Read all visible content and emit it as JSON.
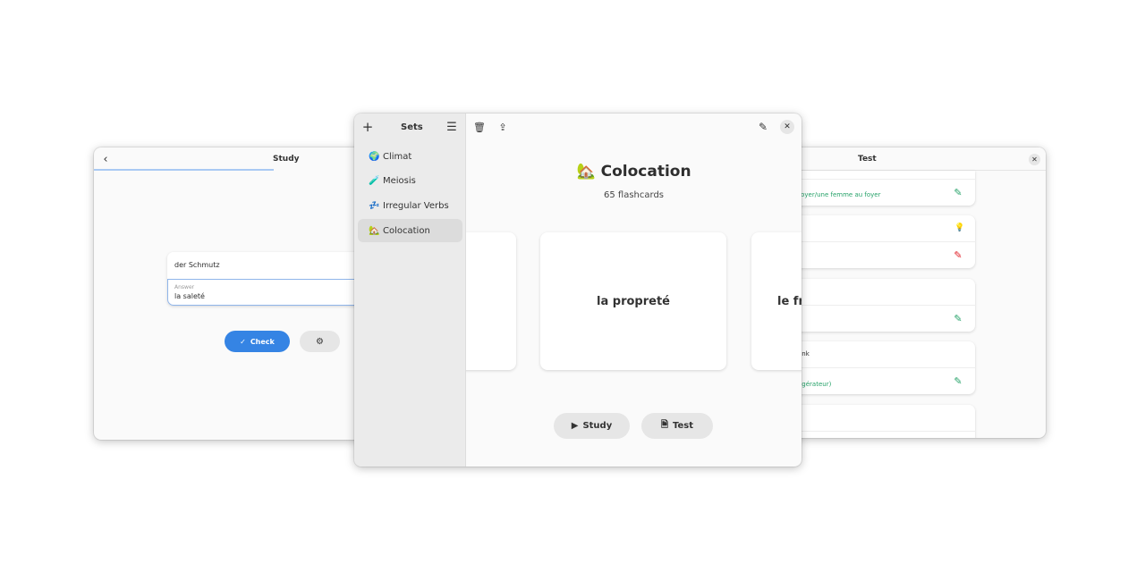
{
  "study_window": {
    "title": "Study",
    "progress": 0.5,
    "question": "der Schmutz",
    "answer_label": "Answer",
    "answer_value": "la saleté",
    "check_label": "Check"
  },
  "test_window": {
    "title": "Test",
    "rows": [
      {
        "answer": "u foyer/une femme au foyer",
        "status": "correct"
      },
      {
        "status": "incorrect"
      },
      {
        "status": "correct"
      },
      {
        "prompt": "ank",
        "answer": "frigérateur)",
        "status": "correct"
      },
      {}
    ]
  },
  "main_window": {
    "sidebar": {
      "title": "Sets",
      "items": [
        {
          "emoji": "🌍",
          "label": "Climat"
        },
        {
          "emoji": "🧪",
          "label": "Meiosis"
        },
        {
          "emoji": "💤",
          "label": "Irregular Verbs"
        },
        {
          "emoji": "🏡",
          "label": "Colocation",
          "selected": true
        }
      ]
    },
    "set": {
      "emoji": "🏡",
      "title": "Colocation",
      "count": "65 flashcards"
    },
    "cards": [
      "",
      "la propreté",
      "le fri"
    ],
    "study_label": "Study",
    "test_label": "Test"
  },
  "colors": {
    "accent": "#3584e4",
    "correct": "#26a269",
    "incorrect": "#e01b24"
  }
}
